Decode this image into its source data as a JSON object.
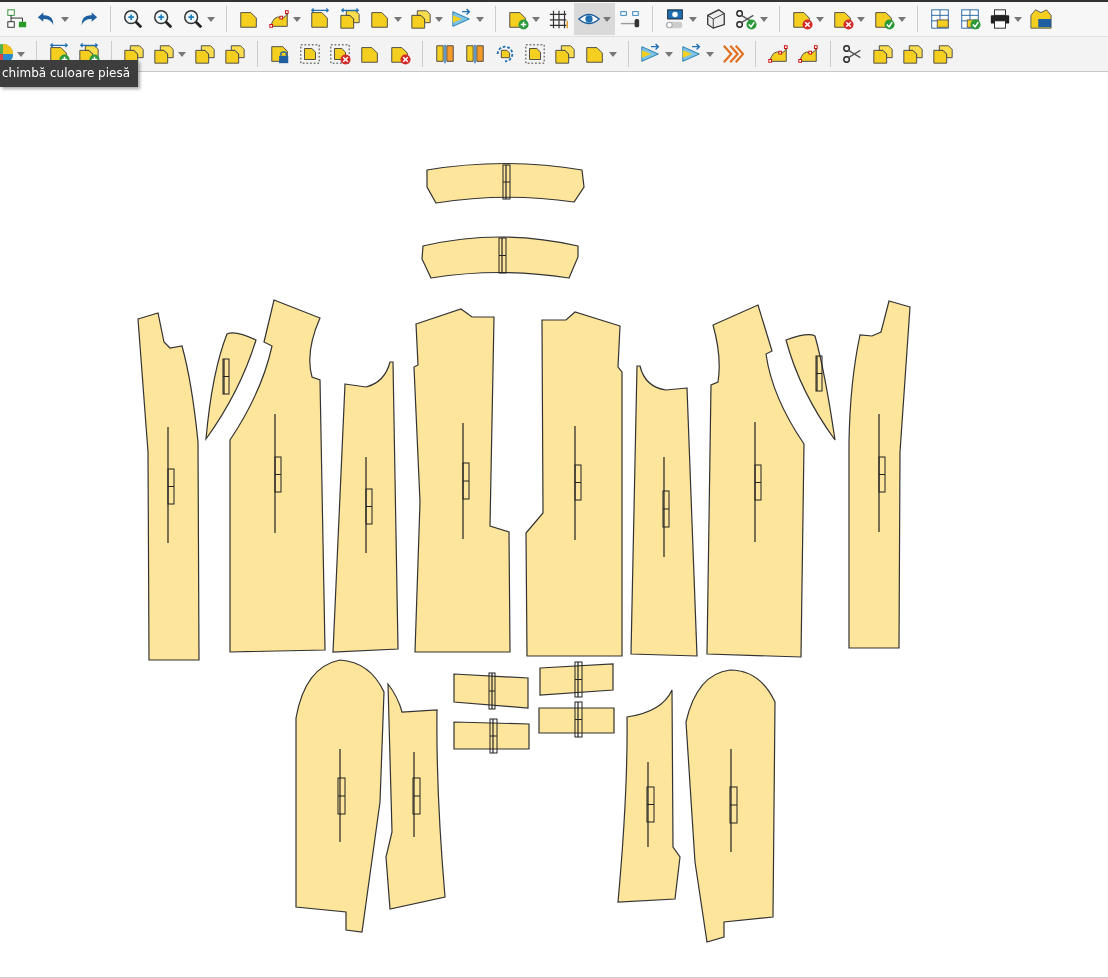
{
  "toolbars": [
    {
      "groups": [
        {
          "buttons": [
            {
              "selected": false,
              "has_menu": false
            },
            {
              "selected": false,
              "has_menu": true
            },
            {
              "selected": false,
              "has_menu": false
            }
          ]
        },
        {
          "buttons": [
            {
              "selected": false,
              "has_menu": false
            },
            {
              "selected": false,
              "has_menu": false
            },
            {
              "selected": false,
              "has_menu": true
            }
          ]
        },
        {
          "buttons": [
            {
              "selected": false,
              "has_menu": false
            },
            {
              "selected": false,
              "has_menu": true
            },
            {
              "selected": false,
              "has_menu": false
            },
            {
              "selected": false,
              "has_menu": false
            },
            {
              "selected": false,
              "has_menu": true
            },
            {
              "selected": false,
              "has_menu": true
            },
            {
              "selected": false,
              "has_menu": true
            }
          ]
        },
        {
          "buttons": [
            {
              "selected": false,
              "has_menu": true
            },
            {
              "selected": false,
              "has_menu": false
            },
            {
              "selected": true,
              "has_menu": true
            },
            {
              "selected": false,
              "has_menu": false
            }
          ]
        },
        {
          "buttons": [
            {
              "selected": false,
              "has_menu": true
            },
            {
              "selected": false,
              "has_menu": false
            },
            {
              "selected": false,
              "has_menu": true
            }
          ]
        },
        {
          "buttons": [
            {
              "selected": false,
              "has_menu": true
            },
            {
              "selected": false,
              "has_menu": true
            },
            {
              "selected": false,
              "has_menu": true
            }
          ]
        },
        {
          "buttons": [
            {
              "selected": false,
              "has_menu": false
            },
            {
              "selected": false,
              "has_menu": false
            },
            {
              "selected": false,
              "has_menu": true
            },
            {
              "selected": false,
              "has_menu": false
            }
          ]
        }
      ]
    },
    {
      "groups": [
        {
          "buttons": [
            {
              "selected": false,
              "has_menu": true
            }
          ]
        },
        {
          "buttons": [
            {
              "selected": false,
              "has_menu": false
            },
            {
              "selected": false,
              "has_menu": false
            }
          ]
        },
        {
          "buttons": [
            {
              "selected": false,
              "has_menu": false
            },
            {
              "selected": false,
              "has_menu": true
            },
            {
              "selected": false,
              "has_menu": false
            },
            {
              "selected": false,
              "has_menu": false
            }
          ]
        },
        {
          "buttons": [
            {
              "selected": false,
              "has_menu": false
            },
            {
              "selected": false,
              "has_menu": false
            },
            {
              "selected": false,
              "has_menu": false
            },
            {
              "selected": false,
              "has_menu": false
            },
            {
              "selected": false,
              "has_menu": false
            }
          ]
        },
        {
          "buttons": [
            {
              "selected": false,
              "has_menu": false
            },
            {
              "selected": false,
              "has_menu": false
            },
            {
              "selected": false,
              "has_menu": false
            },
            {
              "selected": false,
              "has_menu": false
            },
            {
              "selected": false,
              "has_menu": false
            },
            {
              "selected": false,
              "has_menu": true
            }
          ]
        },
        {
          "buttons": [
            {
              "selected": false,
              "has_menu": true
            },
            {
              "selected": false,
              "has_menu": true
            },
            {
              "selected": false,
              "has_menu": false
            }
          ]
        },
        {
          "buttons": [
            {
              "selected": false,
              "has_menu": false
            },
            {
              "selected": false,
              "has_menu": false
            }
          ]
        },
        {
          "buttons": [
            {
              "selected": false,
              "has_menu": false
            },
            {
              "selected": false,
              "has_menu": false
            },
            {
              "selected": false,
              "has_menu": false
            },
            {
              "selected": false,
              "has_menu": false
            }
          ]
        }
      ]
    }
  ],
  "tooltip": {
    "text": "chimbă culoare piesă"
  }
}
